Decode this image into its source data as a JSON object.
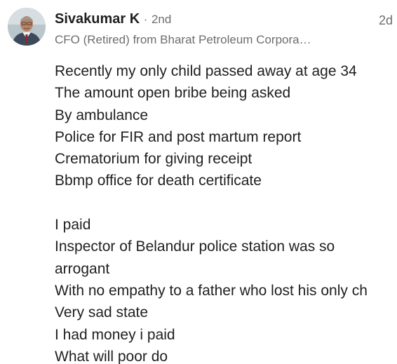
{
  "author": {
    "name": "Sivakumar K",
    "separator": "·",
    "connection_degree": "2nd",
    "headline": "CFO (Retired) from Bharat Petroleum Corpora…",
    "timestamp": "2d"
  },
  "post": {
    "lines": [
      "Recently my only child passed away at age 34",
      "The amount open bribe being asked",
      "By ambulance",
      "Police for FIR and post martum report",
      "Crematorium  for giving receipt",
      "Bbmp office for death certificate",
      "",
      "I paid",
      "Inspector of Belandur police station was so",
      "arrogant",
      "With no empathy to a father who lost his only ch",
      "Very sad state",
      "I had money i paid",
      "What will poor do"
    ]
  }
}
